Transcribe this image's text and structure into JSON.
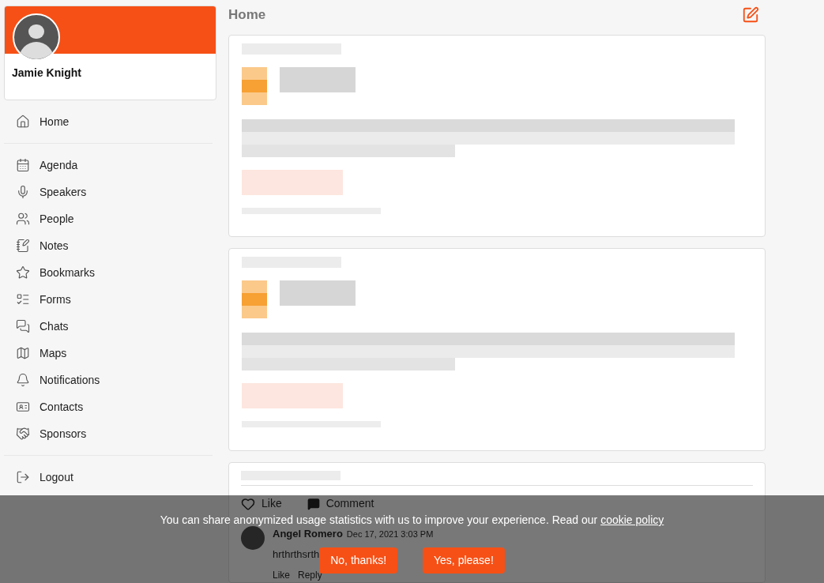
{
  "profile": {
    "name": "Jamie Knight"
  },
  "nav_primary": [
    {
      "label": "Home"
    }
  ],
  "nav_items": [
    {
      "label": "Agenda"
    },
    {
      "label": "Speakers"
    },
    {
      "label": "People"
    },
    {
      "label": "Notes"
    },
    {
      "label": "Bookmarks"
    },
    {
      "label": "Forms"
    },
    {
      "label": "Chats"
    },
    {
      "label": "Maps"
    },
    {
      "label": "Notifications"
    },
    {
      "label": "Contacts"
    },
    {
      "label": "Sponsors"
    }
  ],
  "nav_footer": [
    {
      "label": "Logout"
    }
  ],
  "page_title": "Home",
  "post_actions": [
    "Like",
    "Comment"
  ],
  "comment": {
    "author": "Angel Romero",
    "time": "Dec 17, 2021 3:03 PM",
    "text": "hrthrthsrth",
    "actions": [
      "Like",
      "Reply"
    ]
  },
  "cookie_banner": {
    "text": "You can share anonymized usage statistics with us to improve your experience. Read our",
    "link": "cookie policy",
    "buttons": [
      "No, thanks!",
      "Yes, please!"
    ]
  }
}
